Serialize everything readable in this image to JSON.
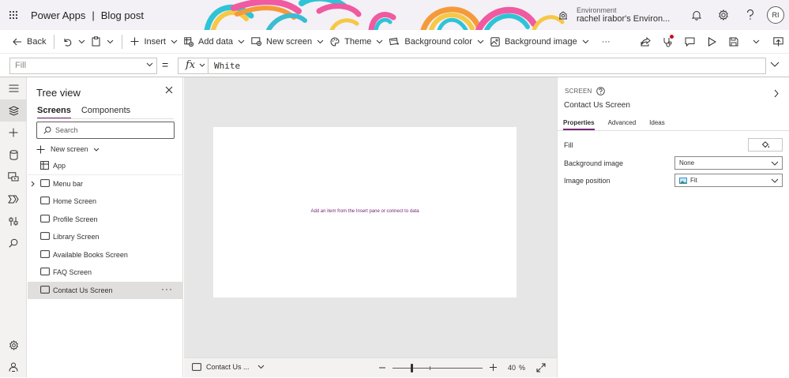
{
  "titlebar": {
    "app_name": "Power Apps",
    "separator": "|",
    "doc_name": "Blog post",
    "environment_label": "Environment",
    "environment_name": "rachel irabor's Environ...",
    "avatar_initials": "RI",
    "icons": [
      "waffle-icon",
      "environment-icon",
      "bell-icon",
      "gear-icon",
      "help-icon"
    ]
  },
  "commandbar": {
    "back": "Back",
    "insert": "Insert",
    "add_data": "Add data",
    "new_screen": "New screen",
    "theme": "Theme",
    "background_color": "Background color",
    "background_image": "Background image",
    "more": "···"
  },
  "formulabar": {
    "property": "Fill",
    "equals": "=",
    "fx": "fx",
    "formula": "White"
  },
  "treeview": {
    "title": "Tree view",
    "tabs": [
      {
        "label": "Screens",
        "active": true
      },
      {
        "label": "Components",
        "active": false
      }
    ],
    "search_placeholder": "Search",
    "new_screen": "New screen",
    "items": [
      {
        "label": "App",
        "icon": "app-icon",
        "caret": false,
        "selected": false
      },
      {
        "label": "Menu bar",
        "icon": "screen-icon",
        "caret": true,
        "selected": false
      },
      {
        "label": "Home Screen",
        "icon": "screen-icon",
        "caret": false,
        "selected": false
      },
      {
        "label": "Profile Screen",
        "icon": "screen-icon",
        "caret": false,
        "selected": false
      },
      {
        "label": "Library Screen",
        "icon": "screen-icon",
        "caret": false,
        "selected": false
      },
      {
        "label": "Available Books Screen",
        "icon": "screen-icon",
        "caret": false,
        "selected": false
      },
      {
        "label": "FAQ Screen",
        "icon": "screen-icon",
        "caret": false,
        "selected": false
      },
      {
        "label": "Contact Us Screen",
        "icon": "screen-icon",
        "caret": false,
        "selected": true
      }
    ],
    "more": "···"
  },
  "canvas": {
    "hint": "Add an item from the Insert pane or connect to data",
    "background": "#e6e6e6",
    "screen_fill": "#ffffff"
  },
  "footer": {
    "screen_name": "Contact Us ...",
    "zoom_value": "40",
    "zoom_unit": "%",
    "zoom_level": 0.4
  },
  "properties": {
    "type_label": "SCREEN",
    "screen_name": "Contact Us Screen",
    "tabs": [
      {
        "label": "Properties",
        "active": true
      },
      {
        "label": "Advanced",
        "active": false
      },
      {
        "label": "Ideas",
        "active": false
      }
    ],
    "fill_label": "Fill",
    "background_image_label": "Background image",
    "background_image_value": "None",
    "image_position_label": "Image position",
    "image_position_value": "Fit"
  },
  "colors": {
    "accent": "#742774",
    "hint_text": "#742774",
    "notification_dot": "#c50f1f"
  }
}
